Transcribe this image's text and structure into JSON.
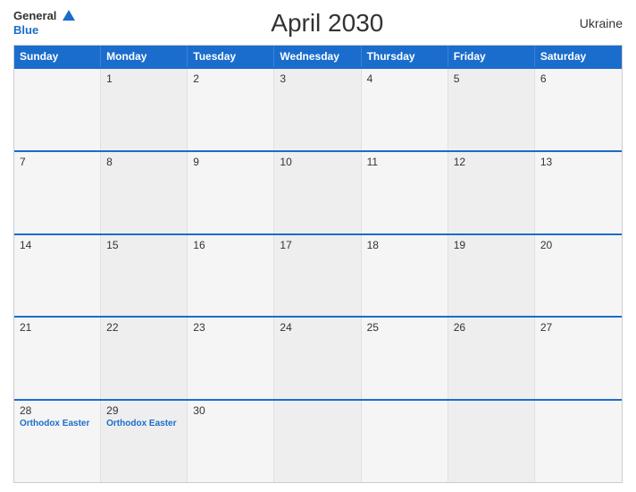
{
  "header": {
    "logo_general": "General",
    "logo_blue": "Blue",
    "title": "April 2030",
    "country": "Ukraine"
  },
  "calendar": {
    "days_of_week": [
      "Sunday",
      "Monday",
      "Tuesday",
      "Wednesday",
      "Thursday",
      "Friday",
      "Saturday"
    ],
    "weeks": [
      [
        {
          "day": "",
          "events": []
        },
        {
          "day": "1",
          "events": []
        },
        {
          "day": "2",
          "events": []
        },
        {
          "day": "3",
          "events": []
        },
        {
          "day": "4",
          "events": []
        },
        {
          "day": "5",
          "events": []
        },
        {
          "day": "6",
          "events": []
        }
      ],
      [
        {
          "day": "7",
          "events": []
        },
        {
          "day": "8",
          "events": []
        },
        {
          "day": "9",
          "events": []
        },
        {
          "day": "10",
          "events": []
        },
        {
          "day": "11",
          "events": []
        },
        {
          "day": "12",
          "events": []
        },
        {
          "day": "13",
          "events": []
        }
      ],
      [
        {
          "day": "14",
          "events": []
        },
        {
          "day": "15",
          "events": []
        },
        {
          "day": "16",
          "events": []
        },
        {
          "day": "17",
          "events": []
        },
        {
          "day": "18",
          "events": []
        },
        {
          "day": "19",
          "events": []
        },
        {
          "day": "20",
          "events": []
        }
      ],
      [
        {
          "day": "21",
          "events": []
        },
        {
          "day": "22",
          "events": []
        },
        {
          "day": "23",
          "events": []
        },
        {
          "day": "24",
          "events": []
        },
        {
          "day": "25",
          "events": []
        },
        {
          "day": "26",
          "events": []
        },
        {
          "day": "27",
          "events": []
        }
      ],
      [
        {
          "day": "28",
          "events": [
            "Orthodox Easter"
          ]
        },
        {
          "day": "29",
          "events": [
            "Orthodox Easter"
          ]
        },
        {
          "day": "30",
          "events": []
        },
        {
          "day": "",
          "events": []
        },
        {
          "day": "",
          "events": []
        },
        {
          "day": "",
          "events": []
        },
        {
          "day": "",
          "events": []
        }
      ]
    ]
  }
}
